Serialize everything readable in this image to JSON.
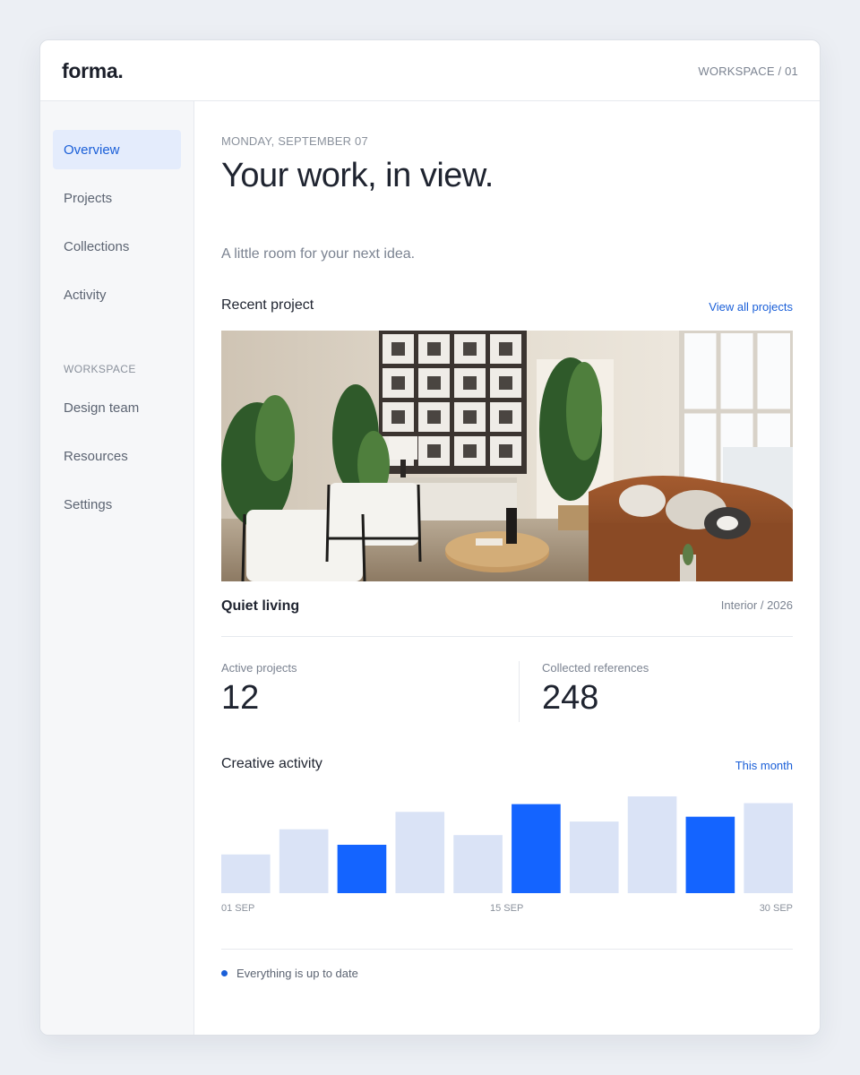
{
  "app": {
    "logo": "forma.",
    "workspace_indicator": "WORKSPACE / 01"
  },
  "sidebar": {
    "items": [
      {
        "label": "Overview",
        "active": true
      },
      {
        "label": "Projects",
        "active": false
      },
      {
        "label": "Collections",
        "active": false
      },
      {
        "label": "Activity",
        "active": false
      }
    ],
    "section_label": "WORKSPACE",
    "workspace_items": [
      {
        "label": "Design team"
      },
      {
        "label": "Resources"
      },
      {
        "label": "Settings"
      }
    ]
  },
  "main": {
    "date": "MONDAY, SEPTEMBER 07",
    "headline": "Your work, in view.",
    "subtitle": "A little room for your next idea.",
    "recent": {
      "title": "Recent project",
      "link": "View all projects",
      "project_name": "Quiet living",
      "project_meta": "Interior / 2026"
    },
    "stats": [
      {
        "label": "Active projects",
        "value": "12"
      },
      {
        "label": "Collected references",
        "value": "248"
      }
    ],
    "activity": {
      "title": "Creative activity",
      "link": "This month"
    },
    "status": "Everything is up to date"
  },
  "colors": {
    "accent": "#1a5fd8",
    "bar_highlight": "#1464ff",
    "bar_muted": "#dae3f6",
    "active_nav_bg": "#e4ecfc"
  },
  "chart_data": {
    "type": "bar",
    "title": "Creative activity",
    "x_tick_labels": [
      "01 SEP",
      "15 SEP",
      "30 SEP"
    ],
    "values": [
      40,
      66,
      50,
      84,
      60,
      92,
      74,
      100,
      79,
      93
    ],
    "highlighted": [
      false,
      false,
      true,
      false,
      false,
      true,
      false,
      false,
      true,
      false
    ],
    "grid": false
  }
}
